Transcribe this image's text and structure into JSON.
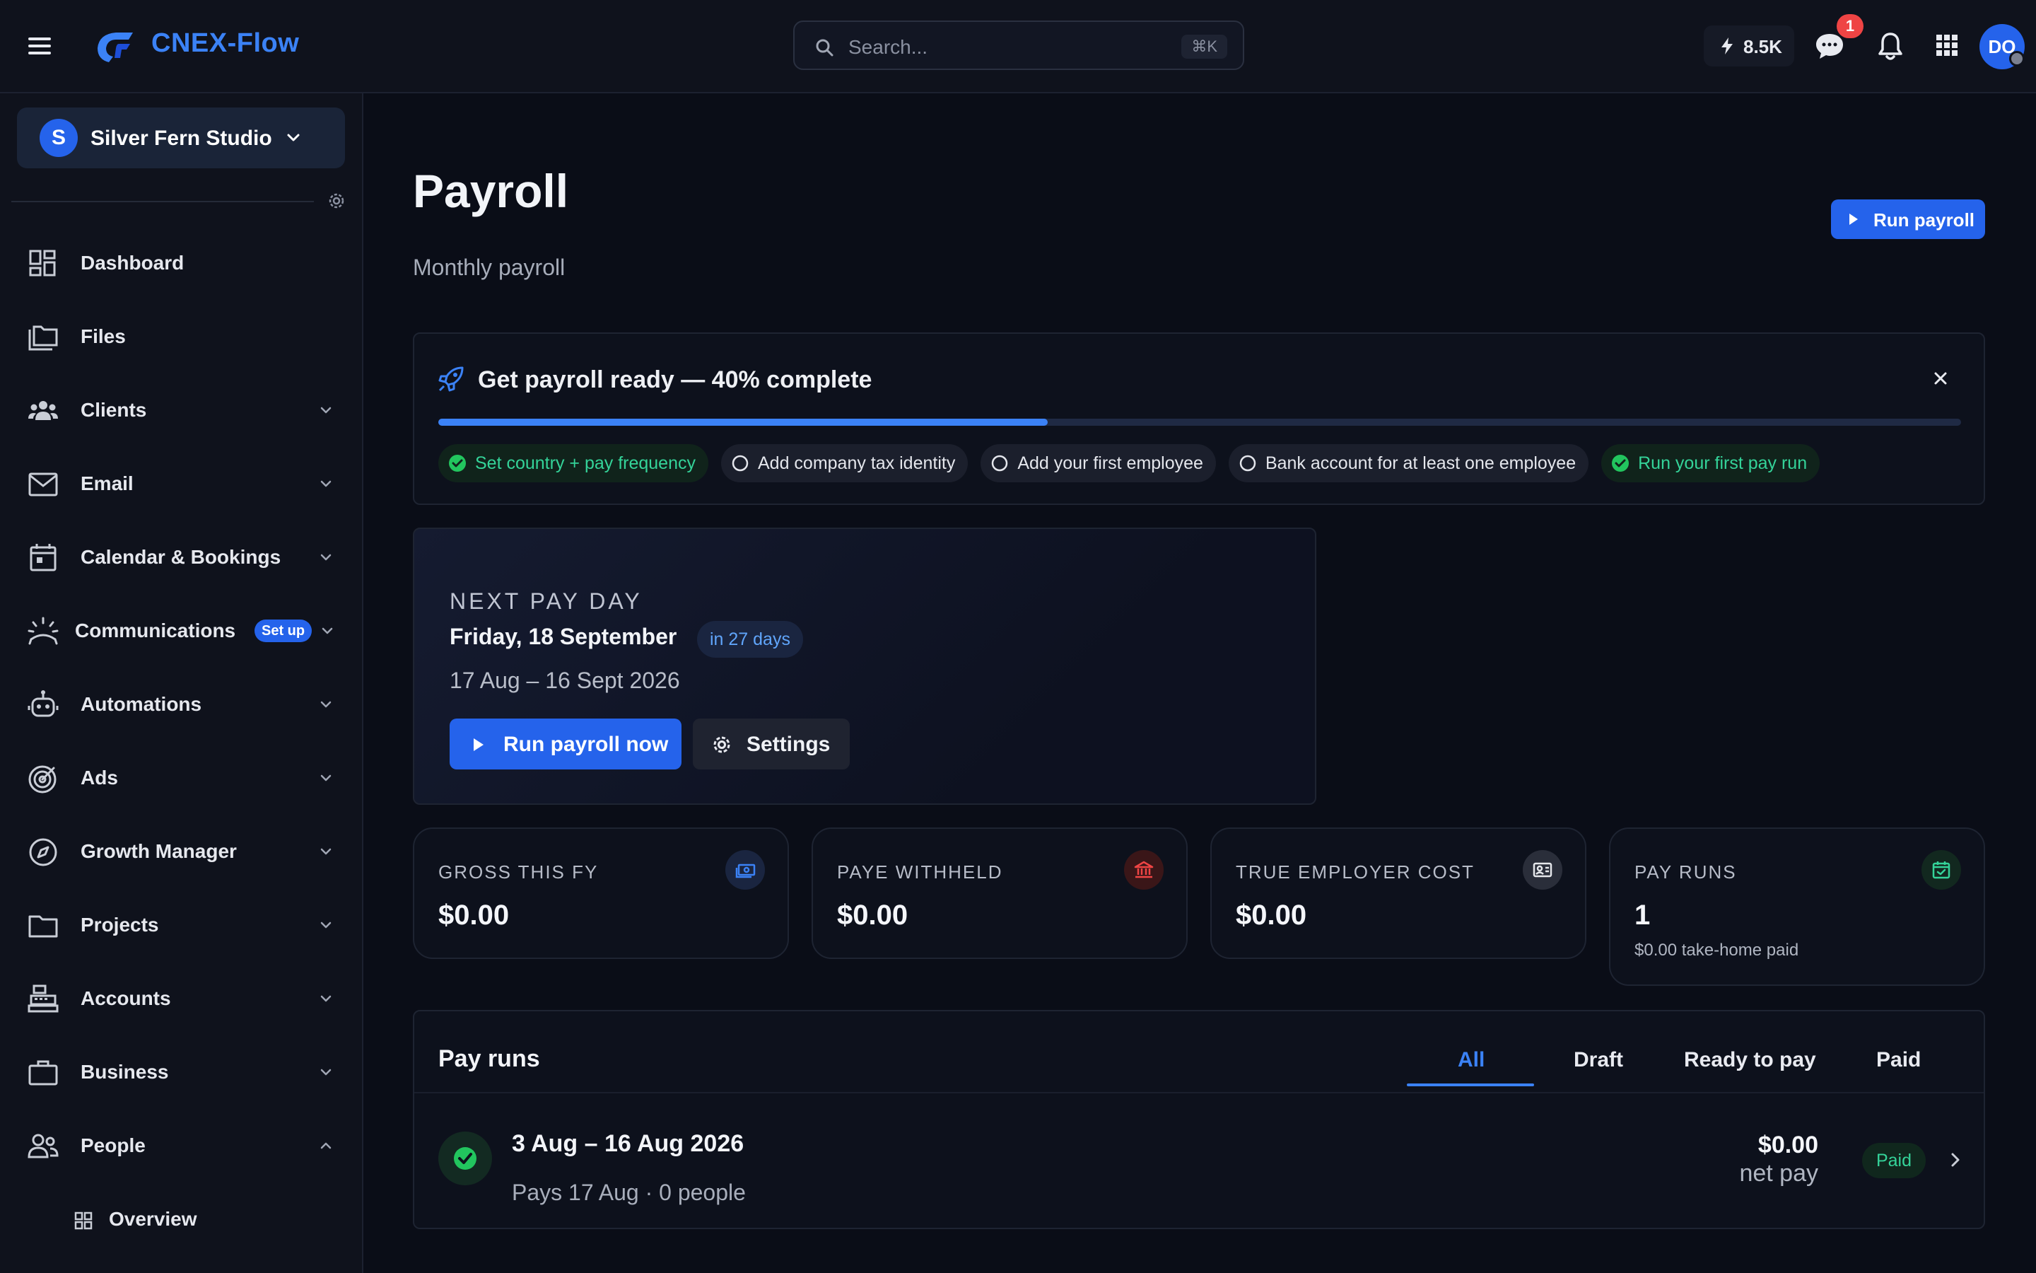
{
  "app": {
    "brand": "CNEX-Flow",
    "search_placeholder": "Search...",
    "search_shortcut": "⌘K",
    "credits": "8.5K",
    "chat_badge": "1",
    "avatar_initials": "DO"
  },
  "sidebar": {
    "workspace_initial": "S",
    "workspace_name": "Silver Fern Studio",
    "items": [
      {
        "label": "Dashboard",
        "icon": "dashboard-icon"
      },
      {
        "label": "Files",
        "icon": "files-icon"
      },
      {
        "label": "Clients",
        "icon": "clients-icon"
      },
      {
        "label": "Email",
        "icon": "email-icon"
      },
      {
        "label": "Calendar & Bookings",
        "icon": "calendar-icon"
      },
      {
        "label": "Communications",
        "icon": "communications-icon",
        "badge": "Set up"
      },
      {
        "label": "Automations",
        "icon": "robot-icon"
      },
      {
        "label": "Ads",
        "icon": "target-icon"
      },
      {
        "label": "Growth Manager",
        "icon": "compass-icon"
      },
      {
        "label": "Projects",
        "icon": "folder-icon"
      },
      {
        "label": "Accounts",
        "icon": "register-icon"
      },
      {
        "label": "Business",
        "icon": "briefcase-icon"
      },
      {
        "label": "People",
        "icon": "people-icon"
      }
    ],
    "sub_items": [
      {
        "label": "Overview",
        "icon": "grid-icon"
      }
    ]
  },
  "page": {
    "title": "Payroll",
    "subtitle": "Monthly payroll",
    "run_payroll_label": "Run payroll"
  },
  "setup": {
    "title": "Get payroll ready — 40% complete",
    "progress": 0.4,
    "steps": [
      {
        "label": "Set country + pay frequency",
        "done": true
      },
      {
        "label": "Add company tax identity",
        "done": false
      },
      {
        "label": "Add your first employee",
        "done": false
      },
      {
        "label": "Bank account for at least one employee",
        "done": false
      },
      {
        "label": "Run your first pay run",
        "done": true
      }
    ]
  },
  "next_pay": {
    "label": "NEXT PAY DAY",
    "date": "Friday, 18 September",
    "in_days": "in 27 days",
    "range": "17 Aug – 16 Sept 2026",
    "run_now_label": "Run payroll now",
    "settings_label": "Settings"
  },
  "stats": [
    {
      "label": "GROSS THIS FY",
      "value": "$0.00",
      "icon": "money-icon",
      "color": "#3b82f6"
    },
    {
      "label": "PAYE WITHHELD",
      "value": "$0.00",
      "icon": "bank-icon",
      "color": "#ef4444"
    },
    {
      "label": "TRUE EMPLOYER COST",
      "value": "$0.00",
      "icon": "id-card-icon",
      "color": "#e5e7eb"
    },
    {
      "label": "PAY RUNS",
      "value": "1",
      "sub": "$0.00 take-home paid",
      "icon": "calendar-check-icon",
      "color": "#34d399"
    }
  ],
  "pay_runs": {
    "title": "Pay runs",
    "tabs": [
      "All",
      "Draft",
      "Ready to pay",
      "Paid"
    ],
    "active_tab": "All",
    "rows": [
      {
        "title": "3 Aug – 16 Aug 2026",
        "subtitle": "Pays 17 Aug · 0 people",
        "amount": "$0.00",
        "amount_label": "net pay",
        "status": "Paid"
      }
    ]
  }
}
